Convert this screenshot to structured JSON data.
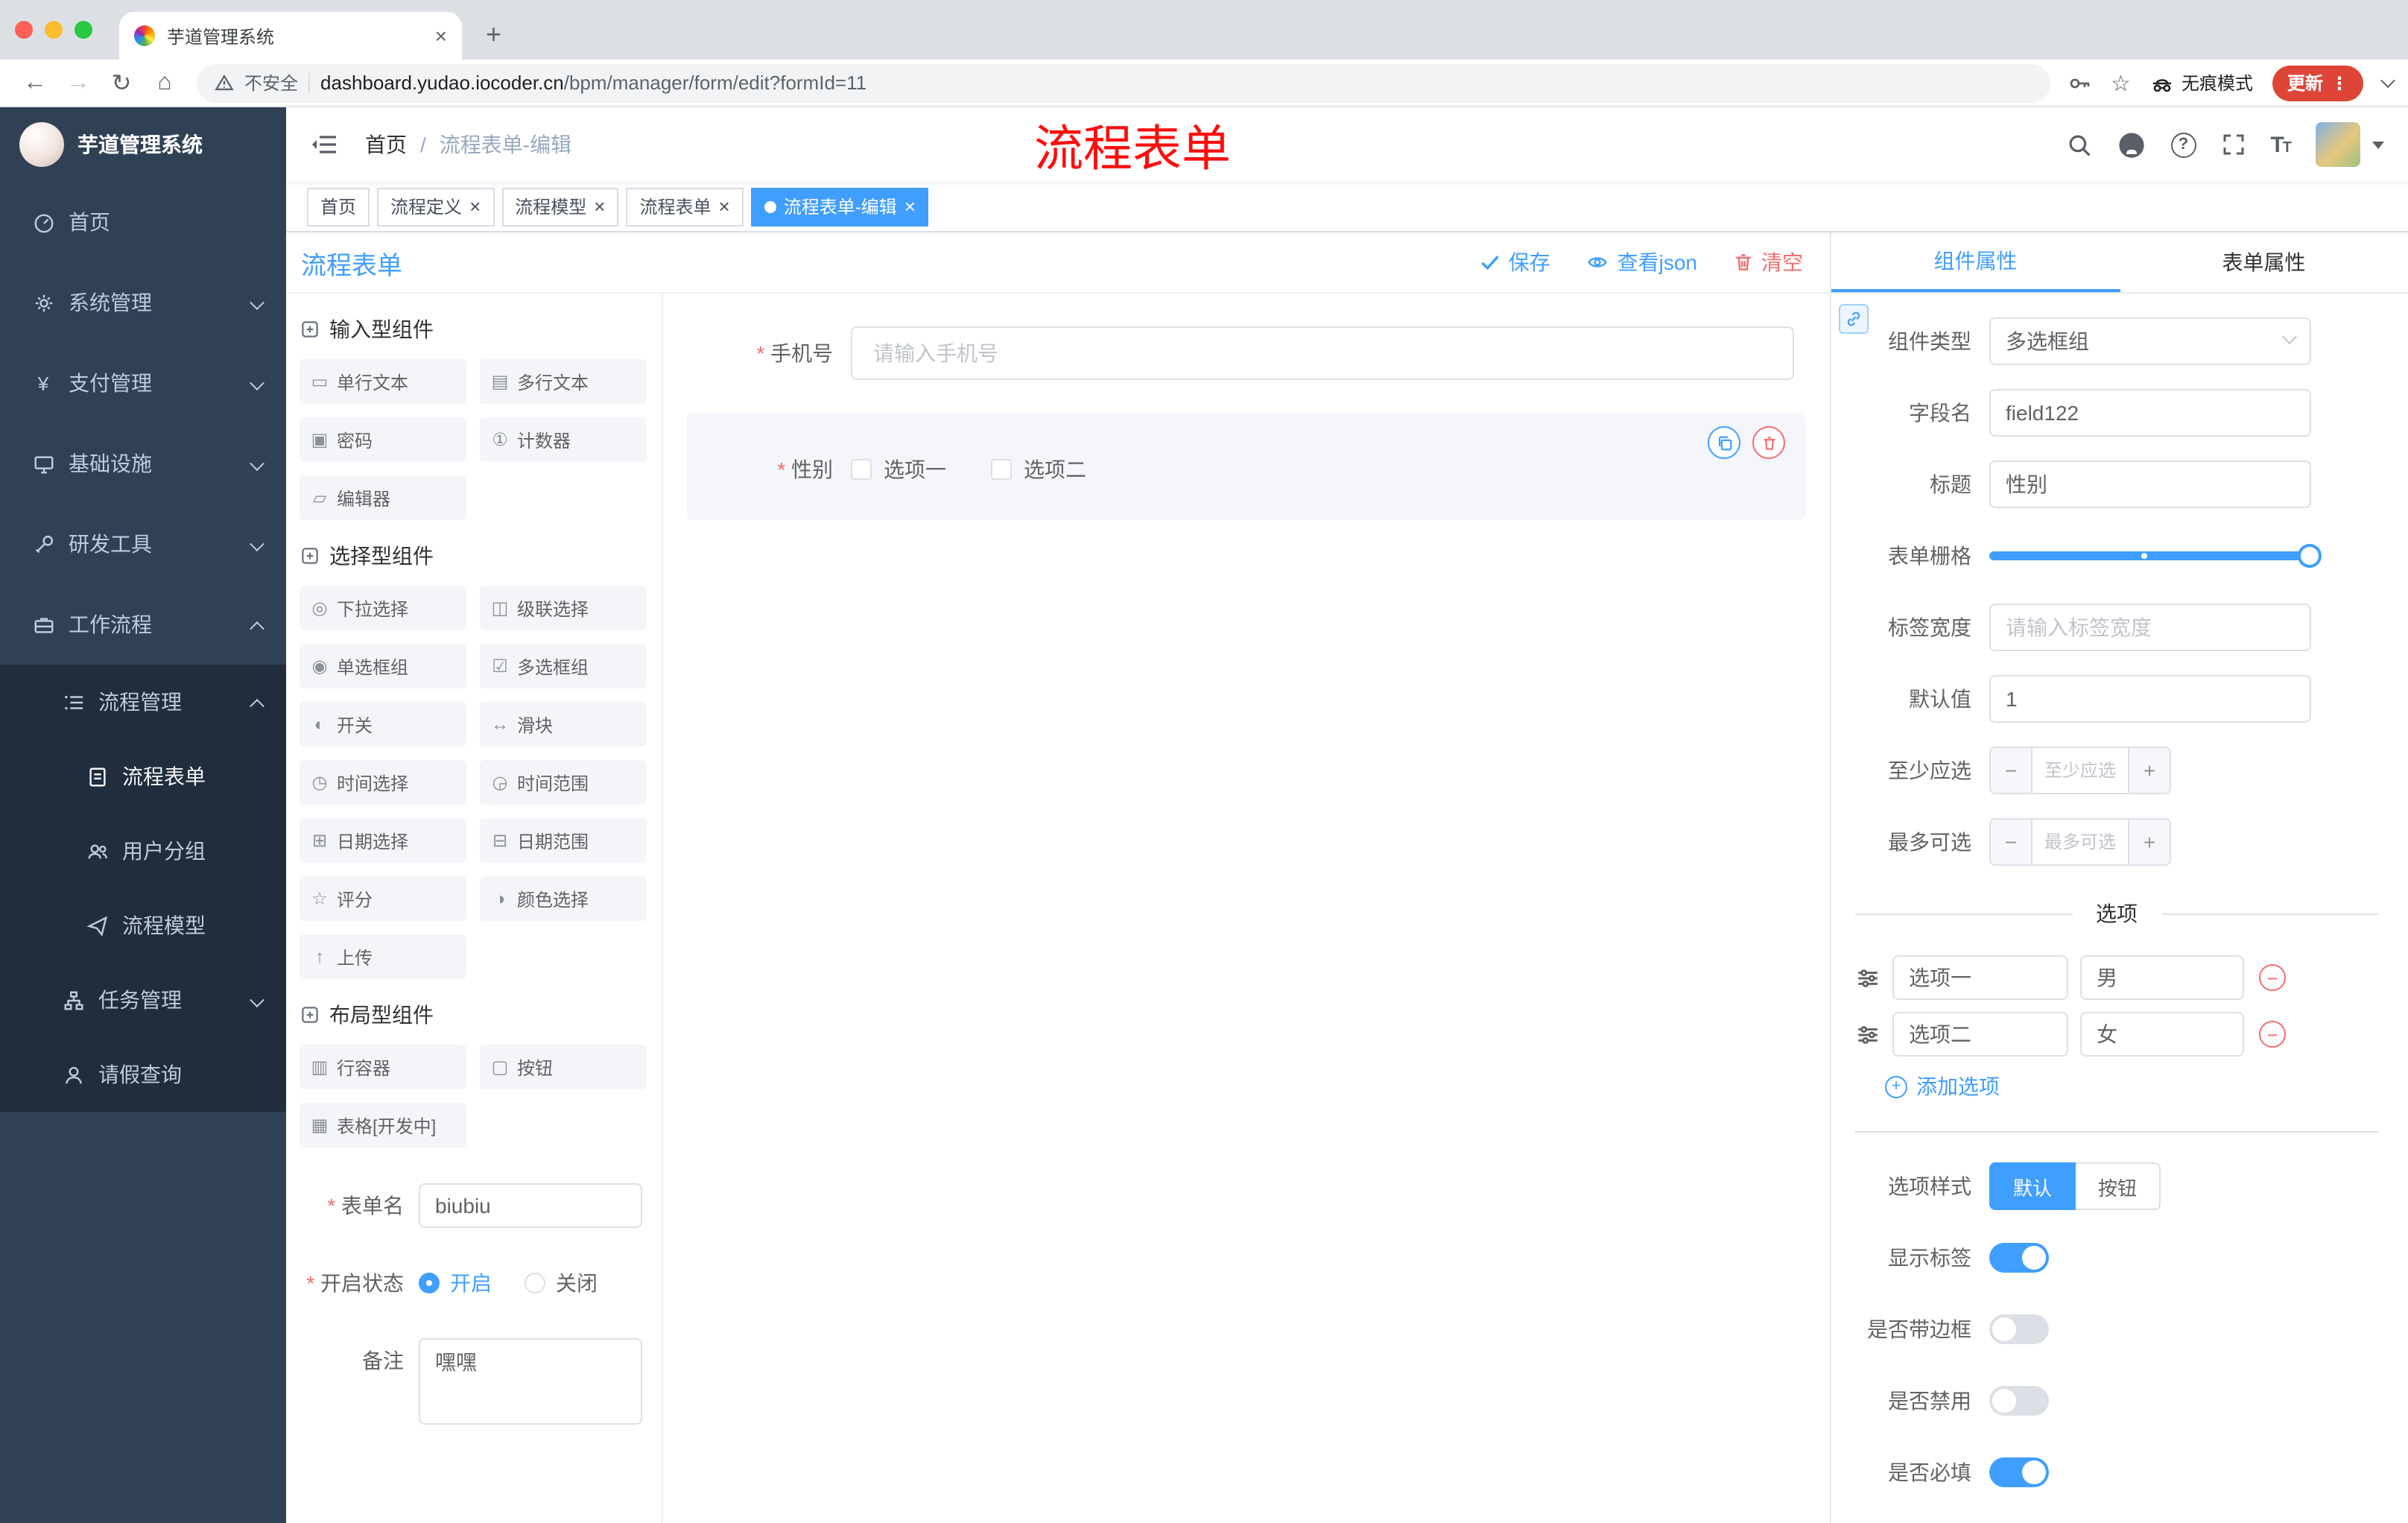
{
  "colors": {
    "accent": "#409eff",
    "danger": "#f56c6c",
    "annotation_red": "#fd0d0d",
    "sidebar_bg": "#304156",
    "submenu_bg": "#1f2d3d"
  },
  "browser": {
    "tab_title": "芋道管理系统",
    "security_label": "不安全",
    "url_host": "dashboard.yudao.iocoder.cn",
    "url_path": "/bpm/manager/form/edit?formId=11",
    "incognito_label": "无痕模式",
    "update_label": "更新"
  },
  "sidebar": {
    "logo_title": "芋道管理系统",
    "items": [
      {
        "label": "首页"
      },
      {
        "label": "系统管理"
      },
      {
        "label": "支付管理"
      },
      {
        "label": "基础设施"
      },
      {
        "label": "研发工具"
      },
      {
        "label": "工作流程"
      },
      {
        "label": "流程管理"
      },
      {
        "label": "流程表单"
      },
      {
        "label": "用户分组"
      },
      {
        "label": "流程模型"
      },
      {
        "label": "任务管理"
      },
      {
        "label": "请假查询"
      }
    ]
  },
  "header": {
    "breadcrumb_home": "首页",
    "breadcrumb_current": "流程表单-编辑",
    "annotation": "流程表单"
  },
  "tags": [
    {
      "label": "首页"
    },
    {
      "label": "流程定义"
    },
    {
      "label": "流程模型"
    },
    {
      "label": "流程表单"
    },
    {
      "label": "流程表单-编辑"
    }
  ],
  "designer": {
    "title": "流程表单",
    "save_label": "保存",
    "view_json_label": "查看json",
    "clear_label": "清空"
  },
  "palette": {
    "sections": [
      {
        "title": "输入型组件",
        "items": [
          {
            "icon": "▭",
            "label": "单行文本"
          },
          {
            "icon": "▤",
            "label": "多行文本"
          },
          {
            "icon": "▣",
            "label": "密码"
          },
          {
            "icon": "①",
            "label": "计数器"
          },
          {
            "icon": "▱",
            "label": "编辑器"
          }
        ]
      },
      {
        "title": "选择型组件",
        "items": [
          {
            "icon": "◎",
            "label": "下拉选择"
          },
          {
            "icon": "◫",
            "label": "级联选择"
          },
          {
            "icon": "◉",
            "label": "单选框组"
          },
          {
            "icon": "☑",
            "label": "多选框组"
          },
          {
            "icon": "◐",
            "label": "开关"
          },
          {
            "icon": "↔",
            "label": "滑块"
          },
          {
            "icon": "◷",
            "label": "时间选择"
          },
          {
            "icon": "◶",
            "label": "时间范围"
          },
          {
            "icon": "⊞",
            "label": "日期选择"
          },
          {
            "icon": "⊟",
            "label": "日期范围"
          },
          {
            "icon": "☆",
            "label": "评分"
          },
          {
            "icon": "◑",
            "label": "颜色选择"
          },
          {
            "icon": "↑",
            "label": "上传"
          }
        ]
      },
      {
        "title": "布局型组件",
        "items": [
          {
            "icon": "▥",
            "label": "行容器"
          },
          {
            "icon": "▢",
            "label": "按钮"
          },
          {
            "icon": "▦",
            "label": "表格[开发中]"
          }
        ]
      }
    ]
  },
  "left_form": {
    "form_name_label": "表单名",
    "form_name_value": "biubiu",
    "status_label": "开启状态",
    "status_on": "开启",
    "status_off": "关闭",
    "remark_label": "备注",
    "remark_value": "嘿嘿"
  },
  "canvas": {
    "phone_label": "手机号",
    "phone_placeholder": "请输入手机号",
    "gender_label": "性别",
    "gender_option1": "选项一",
    "gender_option2": "选项二"
  },
  "props": {
    "tab_component": "组件属性",
    "tab_form": "表单属性",
    "type_label": "组件类型",
    "type_value": "多选框组",
    "field_label": "字段名",
    "field_value": "field122",
    "title_label": "标题",
    "title_value": "性别",
    "grid_label": "表单栅格",
    "label_width_label": "标签宽度",
    "label_width_placeholder": "请输入标签宽度",
    "default_label": "默认值",
    "default_value": "1",
    "min_label": "至少应选",
    "min_placeholder": "至少应选",
    "max_label": "最多可选",
    "max_placeholder": "最多可选",
    "options_divider": "选项",
    "options": [
      {
        "label": "选项一",
        "value": "男"
      },
      {
        "label": "选项二",
        "value": "女"
      }
    ],
    "add_option_label": "添加选项",
    "style_label": "选项样式",
    "style_default": "默认",
    "style_button": "按钮",
    "switch_show_label": "显示标签",
    "switch_border": "是否带边框",
    "switch_disabled": "是否禁用",
    "switch_required": "是否必填"
  }
}
